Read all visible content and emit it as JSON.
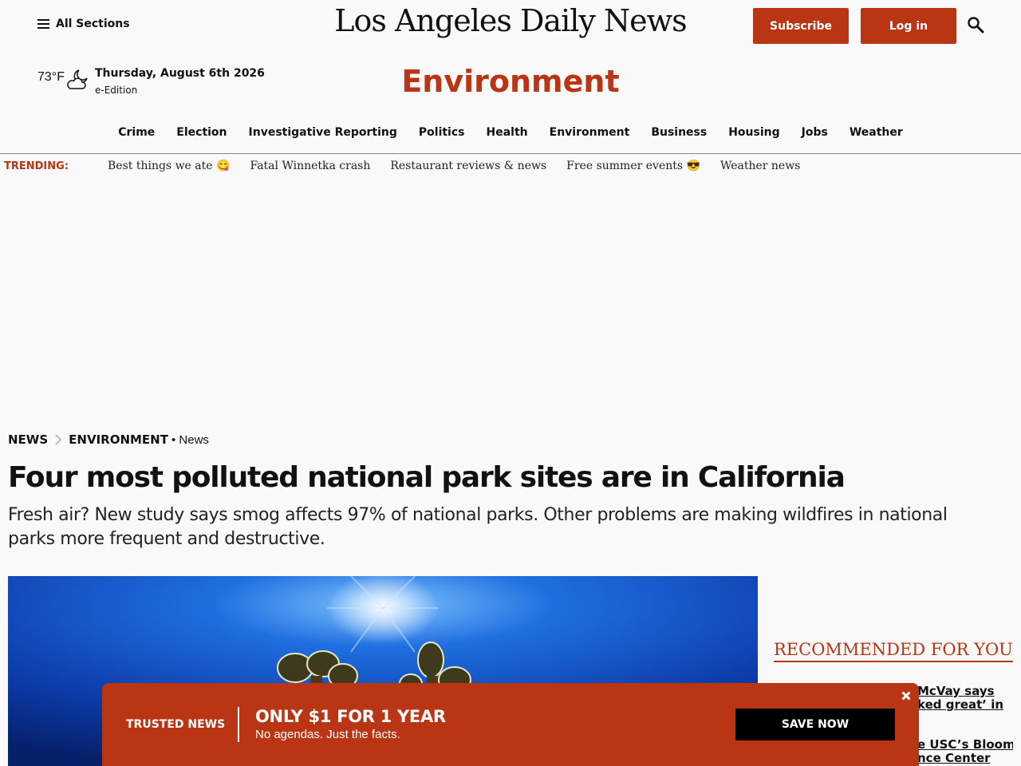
{
  "header": {
    "menu_label": "All Sections",
    "masthead": "Los Angeles Daily News",
    "subscribe_label": "Subscribe",
    "login_label": "Log in",
    "search_icon": "search-icon"
  },
  "weather": {
    "temperature": "73°F",
    "icon": "partly-cloudy-night-icon",
    "date": "Thursday, August 6th 2026",
    "eedition_label": "e-Edition"
  },
  "section_title": "Environment",
  "nav": {
    "items": [
      "Crime",
      "Election",
      "Investigative Reporting",
      "Politics",
      "Health",
      "Environment",
      "Business",
      "Housing",
      "Jobs",
      "Weather"
    ]
  },
  "trending": {
    "label": "TRENDING:",
    "items": [
      "Best things we ate 😋",
      "Fatal Winnetka crash",
      "Restaurant reviews & news",
      "Free summer events 😎",
      "Weather news"
    ]
  },
  "breadcrumb": {
    "level1": "NEWS",
    "level2": "ENVIRONMENT",
    "subtype": "• News"
  },
  "article": {
    "headline": "Four most polluted national park sites are in California",
    "subhead": "Fresh air? New study says smog affects 97% of national parks. Other problems are making wildfires in national parks more frequent and destructive."
  },
  "recommended": {
    "title": "RECOMMENDED FOR YOU",
    "items": [
      "McVay says",
      "ked great’ in",
      "e USC’s Bloom",
      "nce Center"
    ]
  },
  "promo": {
    "tag": "TRUSTED NEWS",
    "offer": "ONLY $1 FOR 1 YEAR",
    "note": "No agendas. Just the facts.",
    "button_label": "SAVE NOW"
  },
  "colors": {
    "brand_red": "#b93514",
    "text": "#111111",
    "background": "#f9f9f9"
  }
}
